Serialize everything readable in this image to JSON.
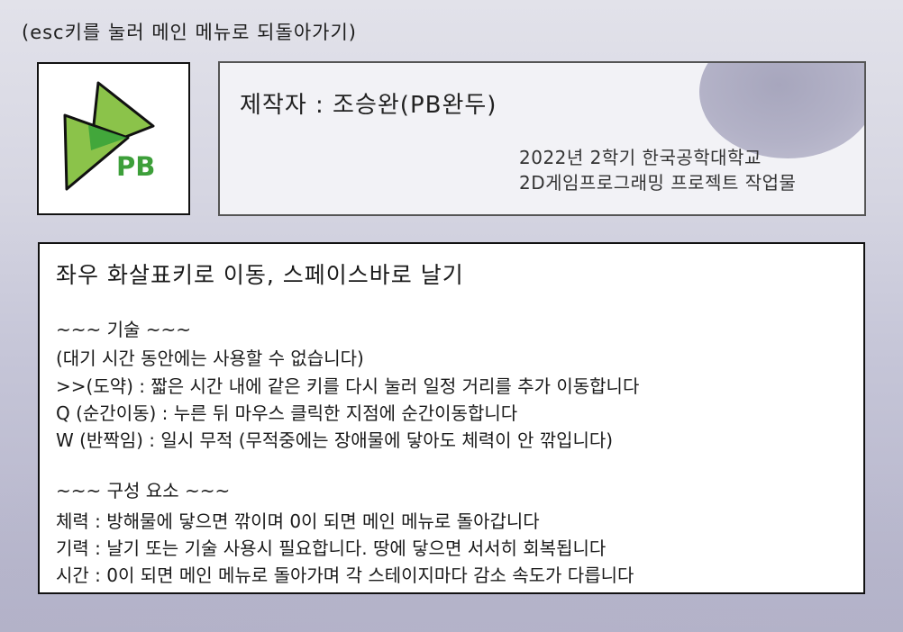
{
  "hint": "(esc키를 눌러 메인 메뉴로 되돌아가기)",
  "logo": {
    "text": "PB",
    "colors": {
      "light_green": "#8bc34a",
      "dark_green": "#3aa43a",
      "text_green": "#3d9f3a",
      "outline": "#111111"
    }
  },
  "credits": {
    "author": "제작자 : 조승완(PB완두)",
    "line1": "2022년 2학기 한국공학대학교",
    "line2": "2D게임프로그래밍 프로젝트 작업물"
  },
  "description": {
    "controls": "좌우 화살표키로 이동, 스페이스바로 날기",
    "skills_header": "~~~ 기술 ~~~",
    "skills_note": "(대기 시간 동안에는 사용할 수 없습니다)",
    "skill_leap": ">>(도약) : 짧은 시간 내에 같은 키를 다시 눌러 일정 거리를 추가 이동합니다",
    "skill_teleport": "Q (순간이동) : 누른 뒤 마우스 클릭한 지점에 순간이동합니다",
    "skill_blink": "W (반짝임) : 일시 무적 (무적중에는 장애물에 닿아도 체력이 안 깎입니다)",
    "components_header": "~~~ 구성 요소 ~~~",
    "health": "체력 : 방해물에 닿으면 깎이며 0이 되면 메인 메뉴로 돌아갑니다",
    "energy": "기력 : 날기 또는 기술 사용시 필요합니다. 땅에 닿으면 서서히 회복됩니다",
    "time": "시간 : 0이 되면 메인 메뉴로 돌아가며 각 스테이지마다 감소 속도가 다릅니다"
  }
}
